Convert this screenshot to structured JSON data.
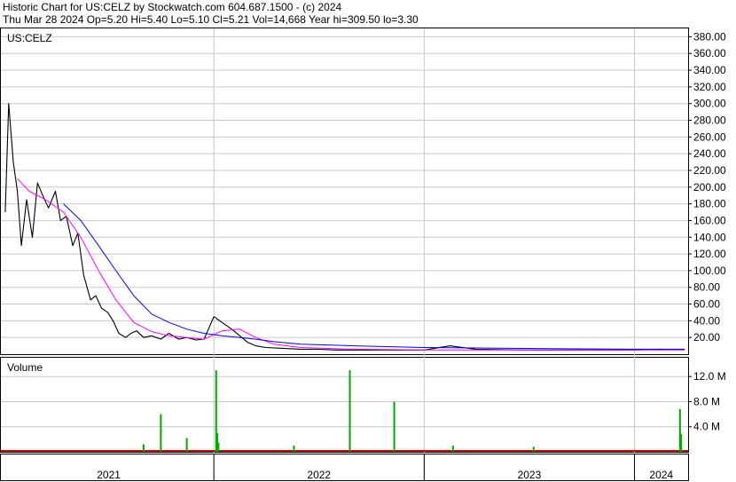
{
  "header": {
    "line1": "Historic Chart for US:CELZ by Stockwatch.com 604.687.1500 - (c) 2024",
    "line2": "Thu Mar 28 2024  Op=5.20  Hi=5.40  Lo=5.10  Cl=5.21  Vol=14,668  Year hi=309.50  lo=3.30"
  },
  "colors": {
    "price": "#000000",
    "ma_short": "#ff00ff",
    "ma_long": "#0000ff",
    "volume_up": "#00aa00",
    "volume_down": "#dd0000",
    "grid": "#c8c8c8"
  },
  "chart_data": [
    {
      "type": "line",
      "title": "US:CELZ",
      "ylim": [
        0,
        390
      ],
      "y_ticks": [
        "380.00",
        "360.00",
        "340.00",
        "320.00",
        "300.00",
        "280.00",
        "260.00",
        "240.00",
        "220.00",
        "200.00",
        "180.00",
        "160.00",
        "140.00",
        "120.00",
        "100.00",
        "80.00",
        "60.00",
        "40.00",
        "20.00"
      ],
      "grid": true,
      "series": [
        {
          "role": "price",
          "x": [
            "2021-01-04",
            "2021-01-10",
            "2021-01-18",
            "2021-01-25",
            "2021-02-01",
            "2021-02-10",
            "2021-02-20",
            "2021-03-01",
            "2021-03-10",
            "2021-03-20",
            "2021-04-01",
            "2021-04-10",
            "2021-04-20",
            "2021-05-01",
            "2021-05-10",
            "2021-05-20",
            "2021-06-01",
            "2021-06-10",
            "2021-06-20",
            "2021-07-01",
            "2021-07-10",
            "2021-07-20",
            "2021-08-01",
            "2021-08-10",
            "2021-08-20",
            "2021-09-01",
            "2021-09-15",
            "2021-10-01",
            "2021-10-15",
            "2021-11-01",
            "2021-11-15",
            "2021-12-01",
            "2021-12-15",
            "2022-01-01",
            "2022-01-15",
            "2022-02-01",
            "2022-02-15",
            "2022-03-01",
            "2022-03-15",
            "2022-04-01",
            "2022-05-01",
            "2022-06-01",
            "2022-07-01",
            "2022-08-01",
            "2022-10-01",
            "2023-01-01",
            "2023-02-15",
            "2023-04-01",
            "2023-07-01",
            "2023-10-01",
            "2024-01-01",
            "2024-02-15",
            "2024-03-28"
          ],
          "values": [
            170,
            300,
            230,
            195,
            130,
            185,
            140,
            205,
            190,
            175,
            195,
            160,
            165,
            130,
            145,
            95,
            65,
            70,
            55,
            50,
            40,
            25,
            20,
            25,
            28,
            20,
            22,
            18,
            25,
            18,
            20,
            17,
            18,
            45,
            38,
            30,
            22,
            14,
            10,
            8,
            7,
            6,
            6,
            5,
            5,
            5,
            10,
            6,
            5,
            5,
            5,
            6,
            5.21
          ]
        },
        {
          "role": "moving-average-short",
          "x": [
            "2021-01-25",
            "2021-02-15",
            "2021-03-15",
            "2021-04-15",
            "2021-05-15",
            "2021-06-15",
            "2021-07-15",
            "2021-08-15",
            "2021-09-15",
            "2021-10-15",
            "2021-11-15",
            "2021-12-15",
            "2022-01-15",
            "2022-02-15",
            "2022-03-15",
            "2022-04-15",
            "2022-06-01",
            "2022-09-01",
            "2023-01-01",
            "2023-06-01",
            "2024-01-01",
            "2024-03-28"
          ],
          "values": [
            210,
            195,
            185,
            170,
            140,
            100,
            65,
            38,
            27,
            22,
            20,
            18,
            28,
            30,
            20,
            12,
            8,
            6,
            5,
            5,
            5,
            5
          ]
        },
        {
          "role": "moving-average-long",
          "x": [
            "2021-04-15",
            "2021-05-15",
            "2021-06-15",
            "2021-07-15",
            "2021-08-15",
            "2021-09-15",
            "2021-10-15",
            "2021-11-15",
            "2021-12-15",
            "2022-01-15",
            "2022-02-15",
            "2022-03-15",
            "2022-04-15",
            "2022-06-01",
            "2022-09-01",
            "2023-01-01",
            "2023-06-01",
            "2024-01-01",
            "2024-03-28"
          ],
          "values": [
            180,
            160,
            130,
            100,
            70,
            48,
            38,
            30,
            25,
            22,
            20,
            18,
            15,
            12,
            10,
            8,
            7,
            6,
            6
          ]
        }
      ]
    },
    {
      "type": "bar",
      "title": "Volume",
      "ylim": [
        0,
        15
      ],
      "y_ticks": [
        "12.0 M",
        "8.0 M",
        "4.0 M"
      ],
      "x": [
        "2021-09-01",
        "2021-10-01",
        "2021-11-15",
        "2022-01-05",
        "2022-01-07",
        "2022-01-09",
        "2022-05-20",
        "2022-08-25",
        "2022-11-10",
        "2023-02-20",
        "2023-07-10",
        "2024-03-20",
        "2024-03-22"
      ],
      "values": [
        1.2,
        6.0,
        2.2,
        13.0,
        3.0,
        1.5,
        1.0,
        13.0,
        8.0,
        1.0,
        0.8,
        6.8,
        2.8
      ]
    }
  ],
  "x_axis": {
    "labels": [
      "2021",
      "2022",
      "2023",
      "2024"
    ]
  }
}
